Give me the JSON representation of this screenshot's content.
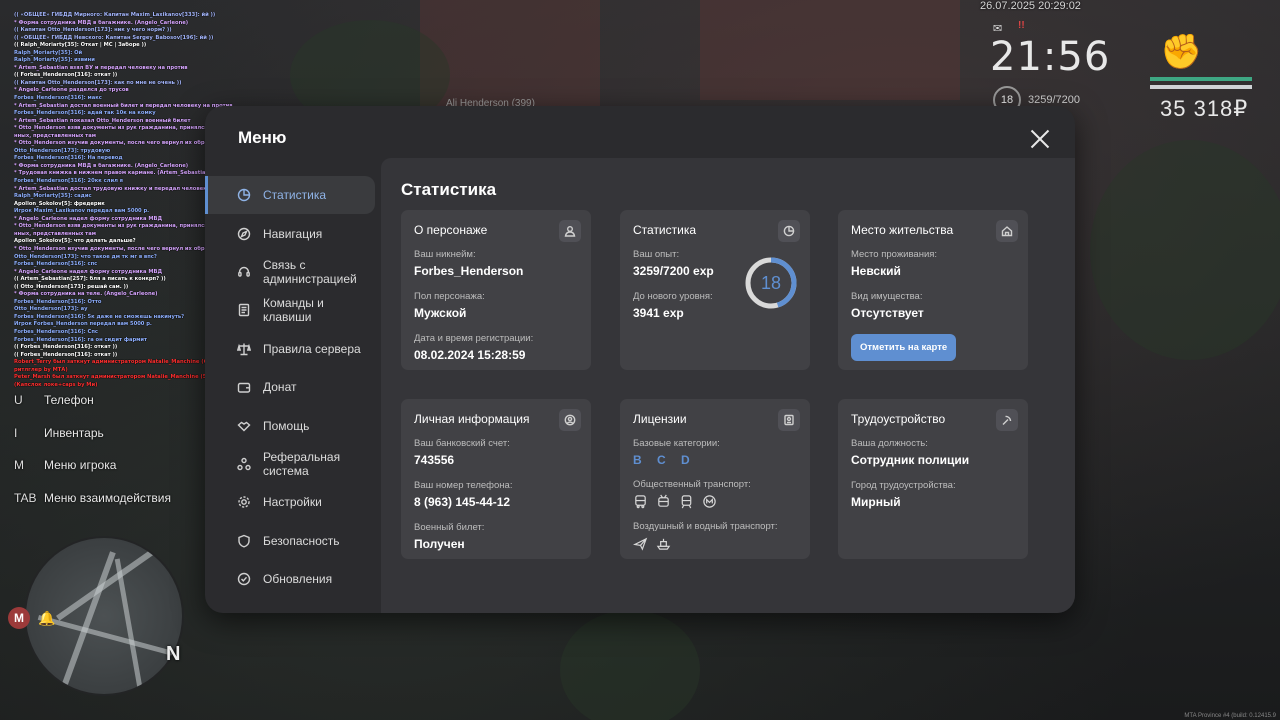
{
  "hud": {
    "date": "26.07.2025 20:29:02",
    "time": "21:56",
    "level": "18",
    "exp": "3259/7200",
    "money": "35 318₽",
    "alert": "!!"
  },
  "player_tag": "Ali Henderson (399)",
  "build": "MTA Province #4 (build: 0.12415.9",
  "chat": [
    {
      "t": "(( «ОБЩЕЕ» ГИБДД Мирного: Капитан Maxim_Laxikanov[333]: йй ))",
      "c": "#a6b8ff"
    },
    {
      "t": " * Форма сотрудника МВД в багажнике. (Angelo_Carleone)",
      "c": "#d7a6ff"
    },
    {
      "t": "(( Капитан Otto_Henderson[173]: ник у чего норм? ))",
      "c": "#a6b8ff"
    },
    {
      "t": "(( «ОБЩЕЕ» ГИБДД Невского: Капитан Sergey_Babosov[196]: йй ))",
      "c": "#a6b8ff"
    },
    {
      "t": "(( Ralph_Moriarty[35]: Откат | МС | Заборе ))",
      "c": "#ffffff"
    },
    {
      "t": "Ralph_Moriarty[35]: Ой",
      "c": "#8fb0ff"
    },
    {
      "t": "Ralph_Moriarty[35]: извини",
      "c": "#8fb0ff"
    },
    {
      "t": " * Artem_Sebastian взял ВУ и передал человеку на против",
      "c": "#d7a6ff"
    },
    {
      "t": "(( Forbes_Henderson[316]: откат ))",
      "c": "#ffffff"
    },
    {
      "t": "(( Капитан Otto_Henderson[173]: как по мне не очень ))",
      "c": "#a6b8ff"
    },
    {
      "t": " * Angelo_Carleone разделся до трусов",
      "c": "#d7a6ff"
    },
    {
      "t": "Forbes_Henderson[316]: макс",
      "c": "#8fb0ff"
    },
    {
      "t": " * Artem_Sebastian достал военный билет и передал человеку на против",
      "c": "#d7a6ff"
    },
    {
      "t": "Forbes_Henderson[316]: адай так 10к на комку",
      "c": "#8fb0ff"
    },
    {
      "t": " * Artem_Sebastian показал Otto_Henderson военный билет",
      "c": "#d7a6ff"
    },
    {
      "t": " * Otto_Henderson взяв документы из рук гражданина, принялся за изучение да",
      "c": "#d7a6ff"
    },
    {
      "t": "нных, представленных там",
      "c": "#d7a6ff"
    },
    {
      "t": " * Otto_Henderson изучив документы, после чего вернул их обратно граждани",
      "c": "#d7a6ff"
    },
    {
      "t": "Otto_Henderson[173]: трудовую",
      "c": "#8fb0ff"
    },
    {
      "t": "Forbes_Henderson[316]: На перевод",
      "c": "#8fb0ff"
    },
    {
      "t": " * Форма сотрудника МВД в багажнике. (Angelo_Carleone)",
      "c": "#d7a6ff"
    },
    {
      "t": " * Трудовая книжка в нижнем правом кармане. (Artem_Sebastian)",
      "c": "#d7a6ff"
    },
    {
      "t": "Forbes_Henderson[316]: 20кк слил я",
      "c": "#8fb0ff"
    },
    {
      "t": " * Artem_Sebastian достал трудовую книжку и передал человеку на против",
      "c": "#d7a6ff"
    },
    {
      "t": "Ralph_Moriarty[35]: садис",
      "c": "#8fb0ff"
    },
    {
      "t": "Apollon_Sokolov[5]: фредерик",
      "c": "#ffffff"
    },
    {
      "t": "Игрок Maxim_Laxikanov передал вам 5000 р.",
      "c": "#8fb0ff"
    },
    {
      "t": " * Angelo_Carleone надел форму сотрудника МВД",
      "c": "#d7a6ff"
    },
    {
      "t": " * Otto_Henderson взяв документы из рук гражданина, принялся за изучение да",
      "c": "#d7a6ff"
    },
    {
      "t": "нных, представленных там",
      "c": "#d7a6ff"
    },
    {
      "t": "Apollon_Sokolov[5]: что делать дальше?",
      "c": "#ffffff"
    },
    {
      "t": " * Otto_Henderson изучив документы, после чего вернул их обратно граждани",
      "c": "#d7a6ff"
    },
    {
      "t": "Otto_Henderson[173]: что такое дм тк мг в впс?",
      "c": "#8fb0ff"
    },
    {
      "t": "Forbes_Henderson[316]: спс",
      "c": "#8fb0ff"
    },
    {
      "t": " * Angelo_Carleone надел форму сотрудника МВД",
      "c": "#d7a6ff"
    },
    {
      "t": "(( Artem_Sebastian[257]: бля а писать к конкрп? ))",
      "c": "#ffffff"
    },
    {
      "t": "(( Otto_Henderson[173]: решай сам. ))",
      "c": "#ffffff"
    },
    {
      "t": " * Форма сотрудника на теле. (Angelo_Carleone)",
      "c": "#d7a6ff"
    },
    {
      "t": "Forbes_Henderson[316]: Отто",
      "c": "#8fb0ff"
    },
    {
      "t": "Otto_Henderson[173]: ау",
      "c": "#8fb0ff"
    },
    {
      "t": "Forbes_Henderson[316]: 5к даже не сможешь накинуть?",
      "c": "#8fb0ff"
    },
    {
      "t": "Игрок Forbes_Henderson передал вам 5000 р.",
      "c": "#8fb0ff"
    },
    {
      "t": "Forbes_Henderson[316]: Спс",
      "c": "#8fb0ff"
    },
    {
      "t": "Forbes_Henderson[316]: га он сидит фармит",
      "c": "#8fb0ff"
    },
    {
      "t": "(( Forbes_Henderson[316]: откат ))",
      "c": "#ffffff"
    },
    {
      "t": "(( Forbes_Henderson[316]: откат ))",
      "c": "#ffffff"
    },
    {
      "t": "Robert_Terry был заткнут администратором Natalie_Manchine (6 мин.) (FG + Иное",
      "c": "#ff3030"
    },
    {
      "t": "ритлглер by МТА)",
      "c": "#ff3030"
    },
    {
      "t": "Peter_Marsh был заткнут администратором Natalie_Manchine (5 мин. 30 мин.)",
      "c": "#ff3030"
    },
    {
      "t": "(Капслок локе+caps by Ми)",
      "c": "#ff3030"
    }
  ],
  "hotkeys": [
    {
      "key": "U",
      "label": "Телефон"
    },
    {
      "key": "I",
      "label": "Инвентарь"
    },
    {
      "key": "M",
      "label": "Меню игрока"
    },
    {
      "key": "TAB",
      "label": "Меню взаимодействия"
    }
  ],
  "minimap": {
    "north": "N",
    "metro": "M"
  },
  "menu": {
    "title": "Меню",
    "nav": [
      {
        "label": "Статистика",
        "icon": "pie-chart-icon",
        "active": true
      },
      {
        "label": "Навигация",
        "icon": "compass-icon"
      },
      {
        "label": "Связь с администрацией",
        "icon": "headset-icon"
      },
      {
        "label": "Команды и клавиши",
        "icon": "document-icon"
      },
      {
        "label": "Правила сервера",
        "icon": "scales-icon"
      },
      {
        "label": "Донат",
        "icon": "wallet-icon"
      },
      {
        "label": "Помощь",
        "icon": "handshake-icon"
      },
      {
        "label": "Реферальная система",
        "icon": "referral-icon"
      },
      {
        "label": "Настройки",
        "icon": "gear-icon"
      },
      {
        "label": "Безопасность",
        "icon": "shield-icon"
      },
      {
        "label": "Обновления",
        "icon": "update-icon"
      }
    ]
  },
  "stats": {
    "title": "Статистика",
    "character": {
      "title": "О персонаже",
      "nickname_label": "Ваш никнейм:",
      "nickname": "Forbes_Henderson",
      "gender_label": "Пол персонажа:",
      "gender": "Мужской",
      "reg_label": "Дата и время регистрации:",
      "reg": "08.02.2024 15:28:59"
    },
    "statistics": {
      "title": "Статистика",
      "exp_label": "Ваш опыт:",
      "exp": "3259/7200 exp",
      "next_label": "До нового уровня:",
      "next": "3941 exp",
      "level": "18",
      "progress": 0.4526
    },
    "residence": {
      "title": "Место жительства",
      "place_label": "Место проживания:",
      "place": "Невский",
      "property_label": "Вид имущества:",
      "property": "Отсутствует",
      "map_button": "Отметить на карте"
    },
    "personal": {
      "title": "Личная информация",
      "bank_label": "Ваш банковский счет:",
      "bank": "743556",
      "phone_label": "Ваш номер телефона:",
      "phone": "8 (963) 145-44-12",
      "military_label": "Военный билет:",
      "military": "Получен"
    },
    "licenses": {
      "title": "Лицензии",
      "base_label": "Базовые категории:",
      "base": "B C D",
      "public_label": "Общественный транспорт:",
      "air_label": "Воздушный и водный транспорт:"
    },
    "employment": {
      "title": "Трудоустройство",
      "position_label": "Ваша должность:",
      "position": "Сотрудник полиции",
      "city_label": "Город трудоустройства:",
      "city": "Мирный"
    }
  },
  "colors": {
    "accent": "#5f8fd1",
    "panel": "#2b2b2e",
    "card": "#414145"
  }
}
